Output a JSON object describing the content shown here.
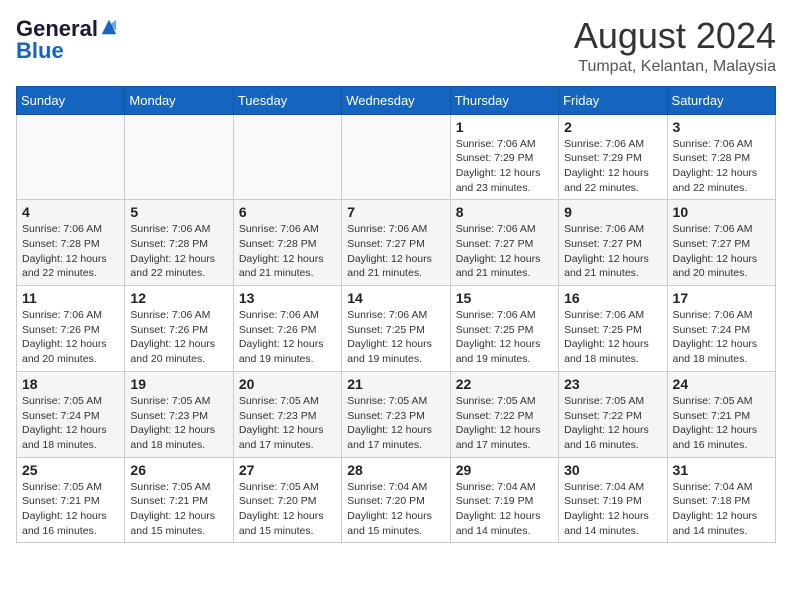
{
  "logo": {
    "general": "General",
    "blue": "Blue"
  },
  "title": "August 2024",
  "subtitle": "Tumpat, Kelantan, Malaysia",
  "days_of_week": [
    "Sunday",
    "Monday",
    "Tuesday",
    "Wednesday",
    "Thursday",
    "Friday",
    "Saturday"
  ],
  "weeks": [
    [
      {
        "day": "",
        "info": ""
      },
      {
        "day": "",
        "info": ""
      },
      {
        "day": "",
        "info": ""
      },
      {
        "day": "",
        "info": ""
      },
      {
        "day": "1",
        "info": "Sunrise: 7:06 AM\nSunset: 7:29 PM\nDaylight: 12 hours\nand 23 minutes."
      },
      {
        "day": "2",
        "info": "Sunrise: 7:06 AM\nSunset: 7:29 PM\nDaylight: 12 hours\nand 22 minutes."
      },
      {
        "day": "3",
        "info": "Sunrise: 7:06 AM\nSunset: 7:28 PM\nDaylight: 12 hours\nand 22 minutes."
      }
    ],
    [
      {
        "day": "4",
        "info": "Sunrise: 7:06 AM\nSunset: 7:28 PM\nDaylight: 12 hours\nand 22 minutes."
      },
      {
        "day": "5",
        "info": "Sunrise: 7:06 AM\nSunset: 7:28 PM\nDaylight: 12 hours\nand 22 minutes."
      },
      {
        "day": "6",
        "info": "Sunrise: 7:06 AM\nSunset: 7:28 PM\nDaylight: 12 hours\nand 21 minutes."
      },
      {
        "day": "7",
        "info": "Sunrise: 7:06 AM\nSunset: 7:27 PM\nDaylight: 12 hours\nand 21 minutes."
      },
      {
        "day": "8",
        "info": "Sunrise: 7:06 AM\nSunset: 7:27 PM\nDaylight: 12 hours\nand 21 minutes."
      },
      {
        "day": "9",
        "info": "Sunrise: 7:06 AM\nSunset: 7:27 PM\nDaylight: 12 hours\nand 21 minutes."
      },
      {
        "day": "10",
        "info": "Sunrise: 7:06 AM\nSunset: 7:27 PM\nDaylight: 12 hours\nand 20 minutes."
      }
    ],
    [
      {
        "day": "11",
        "info": "Sunrise: 7:06 AM\nSunset: 7:26 PM\nDaylight: 12 hours\nand 20 minutes."
      },
      {
        "day": "12",
        "info": "Sunrise: 7:06 AM\nSunset: 7:26 PM\nDaylight: 12 hours\nand 20 minutes."
      },
      {
        "day": "13",
        "info": "Sunrise: 7:06 AM\nSunset: 7:26 PM\nDaylight: 12 hours\nand 19 minutes."
      },
      {
        "day": "14",
        "info": "Sunrise: 7:06 AM\nSunset: 7:25 PM\nDaylight: 12 hours\nand 19 minutes."
      },
      {
        "day": "15",
        "info": "Sunrise: 7:06 AM\nSunset: 7:25 PM\nDaylight: 12 hours\nand 19 minutes."
      },
      {
        "day": "16",
        "info": "Sunrise: 7:06 AM\nSunset: 7:25 PM\nDaylight: 12 hours\nand 18 minutes."
      },
      {
        "day": "17",
        "info": "Sunrise: 7:06 AM\nSunset: 7:24 PM\nDaylight: 12 hours\nand 18 minutes."
      }
    ],
    [
      {
        "day": "18",
        "info": "Sunrise: 7:05 AM\nSunset: 7:24 PM\nDaylight: 12 hours\nand 18 minutes."
      },
      {
        "day": "19",
        "info": "Sunrise: 7:05 AM\nSunset: 7:23 PM\nDaylight: 12 hours\nand 18 minutes."
      },
      {
        "day": "20",
        "info": "Sunrise: 7:05 AM\nSunset: 7:23 PM\nDaylight: 12 hours\nand 17 minutes."
      },
      {
        "day": "21",
        "info": "Sunrise: 7:05 AM\nSunset: 7:23 PM\nDaylight: 12 hours\nand 17 minutes."
      },
      {
        "day": "22",
        "info": "Sunrise: 7:05 AM\nSunset: 7:22 PM\nDaylight: 12 hours\nand 17 minutes."
      },
      {
        "day": "23",
        "info": "Sunrise: 7:05 AM\nSunset: 7:22 PM\nDaylight: 12 hours\nand 16 minutes."
      },
      {
        "day": "24",
        "info": "Sunrise: 7:05 AM\nSunset: 7:21 PM\nDaylight: 12 hours\nand 16 minutes."
      }
    ],
    [
      {
        "day": "25",
        "info": "Sunrise: 7:05 AM\nSunset: 7:21 PM\nDaylight: 12 hours\nand 16 minutes."
      },
      {
        "day": "26",
        "info": "Sunrise: 7:05 AM\nSunset: 7:21 PM\nDaylight: 12 hours\nand 15 minutes."
      },
      {
        "day": "27",
        "info": "Sunrise: 7:05 AM\nSunset: 7:20 PM\nDaylight: 12 hours\nand 15 minutes."
      },
      {
        "day": "28",
        "info": "Sunrise: 7:04 AM\nSunset: 7:20 PM\nDaylight: 12 hours\nand 15 minutes."
      },
      {
        "day": "29",
        "info": "Sunrise: 7:04 AM\nSunset: 7:19 PM\nDaylight: 12 hours\nand 14 minutes."
      },
      {
        "day": "30",
        "info": "Sunrise: 7:04 AM\nSunset: 7:19 PM\nDaylight: 12 hours\nand 14 minutes."
      },
      {
        "day": "31",
        "info": "Sunrise: 7:04 AM\nSunset: 7:18 PM\nDaylight: 12 hours\nand 14 minutes."
      }
    ]
  ]
}
